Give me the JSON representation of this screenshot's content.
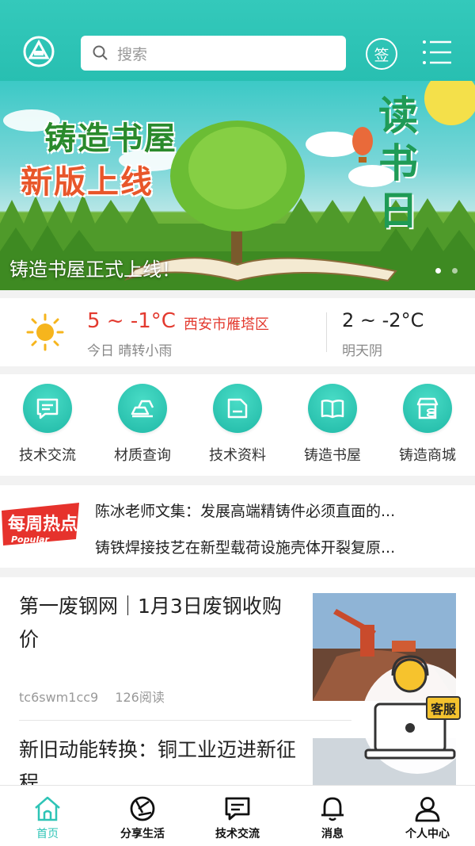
{
  "header": {
    "search_placeholder": "搜索",
    "sign_label": "签"
  },
  "banner": {
    "title_line1": "铸造书屋",
    "title_line2": "新版上线",
    "side_text": "读书日",
    "caption": "铸造书屋正式上线！",
    "slide_count": 2,
    "active_slide": 0
  },
  "weather": {
    "today_temp": "5 ~ -1°C",
    "location": "西安市雁塔区",
    "today_desc": "今日 晴转小雨",
    "tomorrow_temp": "2 ~ -2°C",
    "tomorrow_desc": "明天阴"
  },
  "quick_nav": [
    {
      "label": "技术交流",
      "icon": "chat-icon"
    },
    {
      "label": "材质查询",
      "icon": "ingot-icon"
    },
    {
      "label": "技术资料",
      "icon": "folder-icon"
    },
    {
      "label": "铸造书屋",
      "icon": "book-icon"
    },
    {
      "label": "铸造商城",
      "icon": "store-icon"
    }
  ],
  "hot": {
    "badge_text": "每周热点",
    "badge_sub": "Popular",
    "items": [
      "陈冰老师文集：发展高端精铸件必须直面的...",
      "铸铁焊接技艺在新型载荷设施壳体开裂复原..."
    ]
  },
  "articles": [
    {
      "title": "第一废钢网｜1月3日废钢收购价",
      "author": "tc6swm1cc9",
      "reads": "126阅读"
    },
    {
      "title": "新旧动能转换：铜工业迈进新征程"
    }
  ],
  "service": {
    "label": "客服"
  },
  "tabbar": [
    {
      "label": "首页",
      "icon": "home-icon",
      "active": true
    },
    {
      "label": "分享生活",
      "icon": "aperture-icon",
      "active": false
    },
    {
      "label": "技术交流",
      "icon": "chat-icon",
      "active": false
    },
    {
      "label": "消息",
      "icon": "bell-icon",
      "active": false
    },
    {
      "label": "个人中心",
      "icon": "person-icon",
      "active": false
    }
  ],
  "colors": {
    "accent": "#2ec4b6",
    "warning_red": "#e33a2f"
  }
}
